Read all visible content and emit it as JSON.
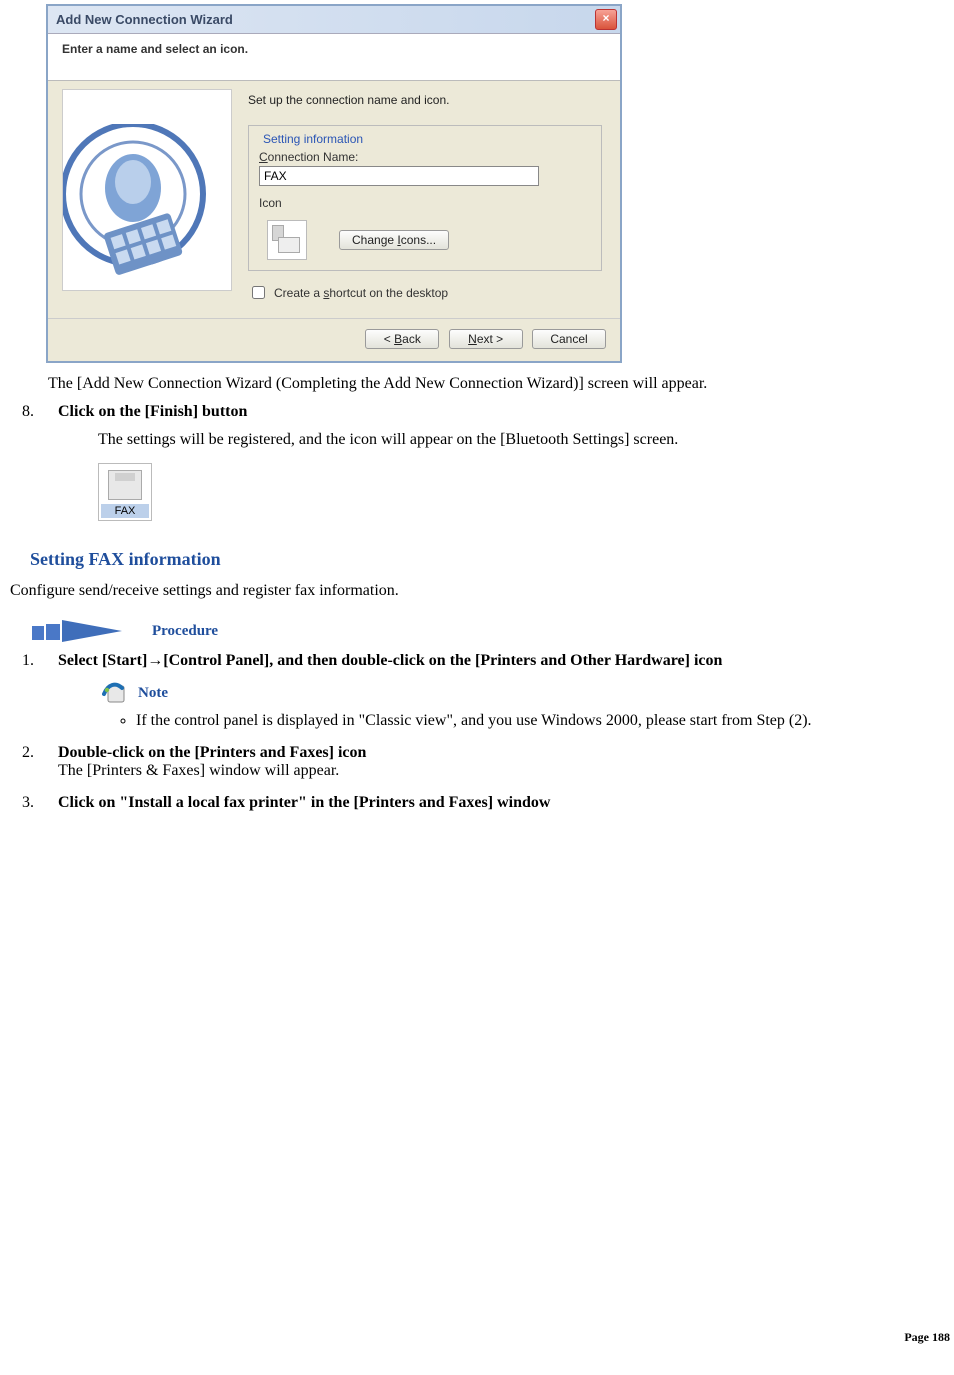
{
  "wizard": {
    "title": "Add New Connection Wizard",
    "header": "Enter a name and select an icon.",
    "instruction": "Set up the connection name and icon.",
    "fieldset_legend": "Setting information",
    "conn_label": "Connection Name:",
    "conn_value": "FAX",
    "icon_label": "Icon",
    "change_icons_btn": "Change Icons...",
    "shortcut_checkbox": "Create a shortcut on the desktop",
    "back_btn": "< Back",
    "next_btn": "Next >",
    "cancel_btn": "Cancel"
  },
  "doc": {
    "line_after_wizard": "The [Add New Connection Wizard (Completing the Add New Connection Wizard)] screen will appear.",
    "step8_title": "Click on the [Finish] button",
    "step8_body": "The settings will be registered, and the icon will appear on the [Bluetooth Settings] screen.",
    "fax_icon_label": "FAX",
    "section_title": "Setting FAX information",
    "section_desc": "Configure send/receive settings and register fax information.",
    "procedure_label": "Procedure",
    "step1": "Select [Start]→[Control Panel], and then double-click on the [Printers and Other Hardware] icon",
    "note_label": "Note",
    "note_bullet": "If the control panel is displayed in \"Classic view\", and you use Windows 2000, please start from Step (2).",
    "step2_title": "Double-click on the [Printers and Faxes] icon",
    "step2_body": "The [Printers & Faxes] window will appear.",
    "step3": "Click on \"Install a local fax printer\" in the [Printers and Faxes] window",
    "page_number": "Page 188"
  }
}
